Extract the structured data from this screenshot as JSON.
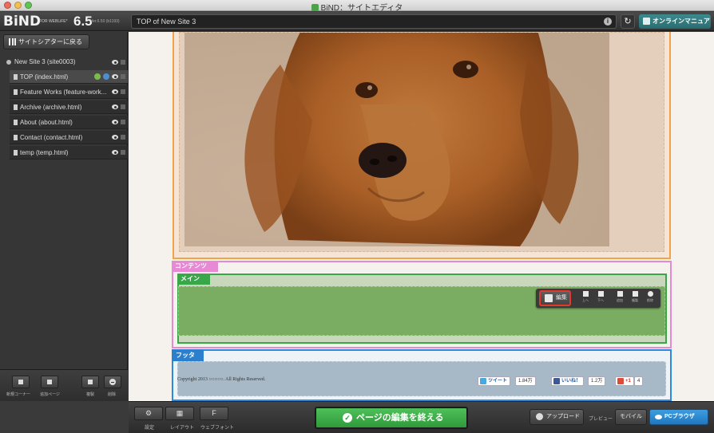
{
  "window": {
    "title": "BiND：サイトエディタ"
  },
  "toolbar": {
    "logo": "BiND",
    "logo_sub": "FOR WEBLiFE*",
    "version": "6.5",
    "build": "Ver.6.50 (b1193)",
    "url": "TOP of New Site 3",
    "manual_label": "オンラインマニュアル"
  },
  "sidebar": {
    "back_label": "サイトシアターに戻る",
    "site": "New Site 3 (site0003)",
    "pages": [
      {
        "label": "TOP (index.html)"
      },
      {
        "label": "Feature Works (feature-work..."
      },
      {
        "label": "Archive (archive.html)"
      },
      {
        "label": "About (about.html)"
      },
      {
        "label": "Contact (contact.html)"
      },
      {
        "label": "temp (temp.html)"
      }
    ],
    "bottom": {
      "new_corner": "新規コーナー",
      "add_page": "追加ページ",
      "duplicate": "複製",
      "delete": "削除"
    }
  },
  "canvas": {
    "content_tag": "コンテンツ",
    "main_tag": "メイン",
    "footer_tag": "フッタ",
    "edit_label": "編集",
    "edit_tools": [
      "上へ",
      "下へ",
      "追加",
      "複製",
      "削除"
    ],
    "copyright": "Copyright 2013 ○○○○○. All Rights Reserved.",
    "tweet_label": "ツイート",
    "tweet_count": "1.84万",
    "like_label": "いいね！",
    "like_count": "1.2万",
    "gplus_label": "+1",
    "gplus_count": "4"
  },
  "bottombar": {
    "settings": "設定",
    "layout": "レイアウト",
    "webfont": "ウェブフォント",
    "finish": "ページの編集を終える",
    "upload": "アップロード",
    "preview": "プレビュー",
    "mobile": "モバイル",
    "pc": "PCブラウザ"
  },
  "colors": {
    "finish_green": "#3aa64a",
    "content_pink": "#e38ad2",
    "main_green": "#3aa64a",
    "footer_blue": "#2a8ae0",
    "hero_orange": "#f0a44a",
    "highlight_red": "#e13a2a"
  }
}
